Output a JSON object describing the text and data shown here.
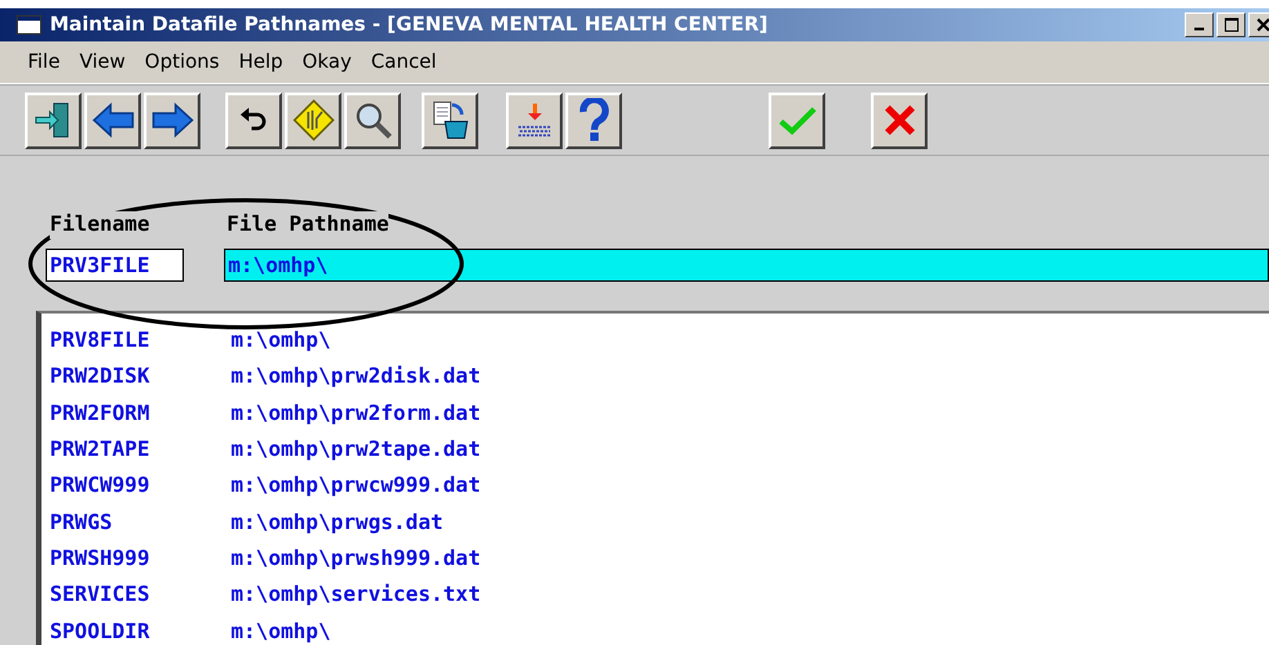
{
  "window": {
    "title": "Maintain Datafile Pathnames - [GENEVA MENTAL HEALTH CENTER]"
  },
  "menu": [
    "File",
    "View",
    "Options",
    "Help",
    "Okay",
    "Cancel"
  ],
  "toolbar": [
    {
      "kind": "exit"
    },
    {
      "kind": "back"
    },
    {
      "kind": "forward"
    },
    {
      "kind": "undo"
    },
    {
      "kind": "diamond"
    },
    {
      "kind": "search"
    },
    {
      "kind": "copy"
    },
    {
      "kind": "heater"
    },
    {
      "kind": "help"
    },
    {
      "kind": "ok"
    },
    {
      "kind": "cancel"
    }
  ],
  "columns": [
    "Filename",
    "File Pathname"
  ],
  "editor": {
    "filename": "PRV3FILE",
    "pathname": "m:\\omhp\\"
  },
  "rows": [
    {
      "filename": "PRV8FILE",
      "pathname": "m:\\omhp\\"
    },
    {
      "filename": "PRW2DISK",
      "pathname": "m:\\omhp\\prw2disk.dat"
    },
    {
      "filename": "PRW2FORM",
      "pathname": "m:\\omhp\\prw2form.dat"
    },
    {
      "filename": "PRW2TAPE",
      "pathname": "m:\\omhp\\prw2tape.dat"
    },
    {
      "filename": "PRWCW999",
      "pathname": "m:\\omhp\\prwcw999.dat"
    },
    {
      "filename": "PRWGS",
      "pathname": "m:\\omhp\\prwgs.dat"
    },
    {
      "filename": "PRWSH999",
      "pathname": "m:\\omhp\\prwsh999.dat"
    },
    {
      "filename": "SERVICES",
      "pathname": "m:\\omhp\\services.txt"
    },
    {
      "filename": "SPOOLDIR",
      "pathname": "m:\\omhp\\"
    }
  ]
}
